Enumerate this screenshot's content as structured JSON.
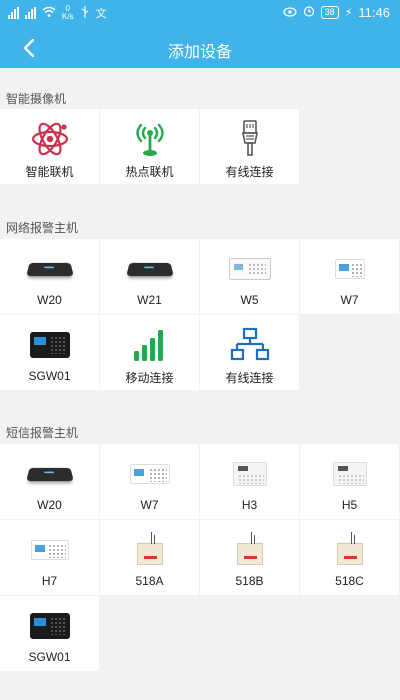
{
  "status_bar": {
    "network_speed_value": "0",
    "network_speed_unit": "K/s",
    "battery": "38",
    "time": "11:46"
  },
  "header": {
    "title": "添加设备"
  },
  "sections": [
    {
      "title": "智能摄像机",
      "items": [
        {
          "label": "智能联机",
          "icon": "atom-icon"
        },
        {
          "label": "热点联机",
          "icon": "hotspot-antenna-icon"
        },
        {
          "label": "有线连接",
          "icon": "ethernet-plug-icon"
        }
      ]
    },
    {
      "title": "网络报警主机",
      "items": [
        {
          "label": "W20",
          "icon": "black-hub-device"
        },
        {
          "label": "W21",
          "icon": "black-hub-device"
        },
        {
          "label": "W5",
          "icon": "white-panel-device"
        },
        {
          "label": "W7",
          "icon": "white-keypad-device"
        },
        {
          "label": "SGW01",
          "icon": "black-touch-panel-device"
        },
        {
          "label": "移动连接",
          "icon": "signal-bars-icon"
        },
        {
          "label": "有线连接",
          "icon": "network-topology-icon"
        }
      ]
    },
    {
      "title": "短信报警主机",
      "items": [
        {
          "label": "W20",
          "icon": "black-hub-device"
        },
        {
          "label": "W7",
          "icon": "white-keypad-device"
        },
        {
          "label": "H3",
          "icon": "white-panel-device"
        },
        {
          "label": "H5",
          "icon": "white-panel-device"
        },
        {
          "label": "H7",
          "icon": "white-keypad-device"
        },
        {
          "label": "518A",
          "icon": "beige-box-device"
        },
        {
          "label": "518B",
          "icon": "beige-box-device"
        },
        {
          "label": "518C",
          "icon": "beige-box-device"
        },
        {
          "label": "SGW01",
          "icon": "black-touch-panel-device"
        }
      ]
    }
  ],
  "colors": {
    "app_bar": "#3fb3ea",
    "accent_red": "#c8324a",
    "accent_green": "#27a84a",
    "accent_blue": "#1e6fc2"
  }
}
